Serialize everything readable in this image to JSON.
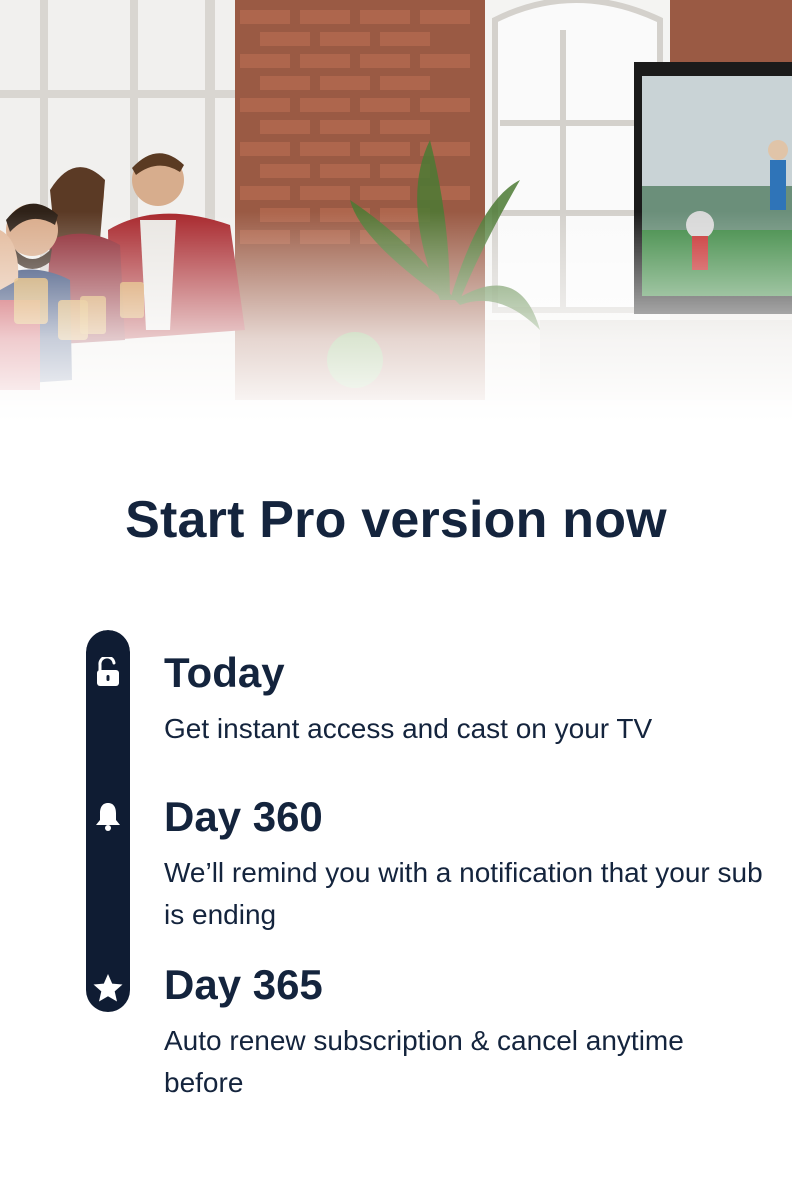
{
  "hero": {
    "image_description_icon": "friends-watching-football-photo"
  },
  "headline": {
    "prefix": "Start ",
    "bold": "Pro version",
    "suffix": " now"
  },
  "timeline": {
    "steps": [
      {
        "icon": "unlock-icon",
        "title": "Today",
        "description": "Get instant access and cast on your TV"
      },
      {
        "icon": "bell-icon",
        "title": "Day 360",
        "description": "We’ll remind you with a notification that your sub is ending"
      },
      {
        "icon": "star-icon",
        "title": "Day 365",
        "description": "Auto renew subscription & cancel anytime before"
      }
    ]
  },
  "colors": {
    "text": "#14243d",
    "track_dark": "#0f1c33",
    "track_blue": "#3d8ef5"
  }
}
